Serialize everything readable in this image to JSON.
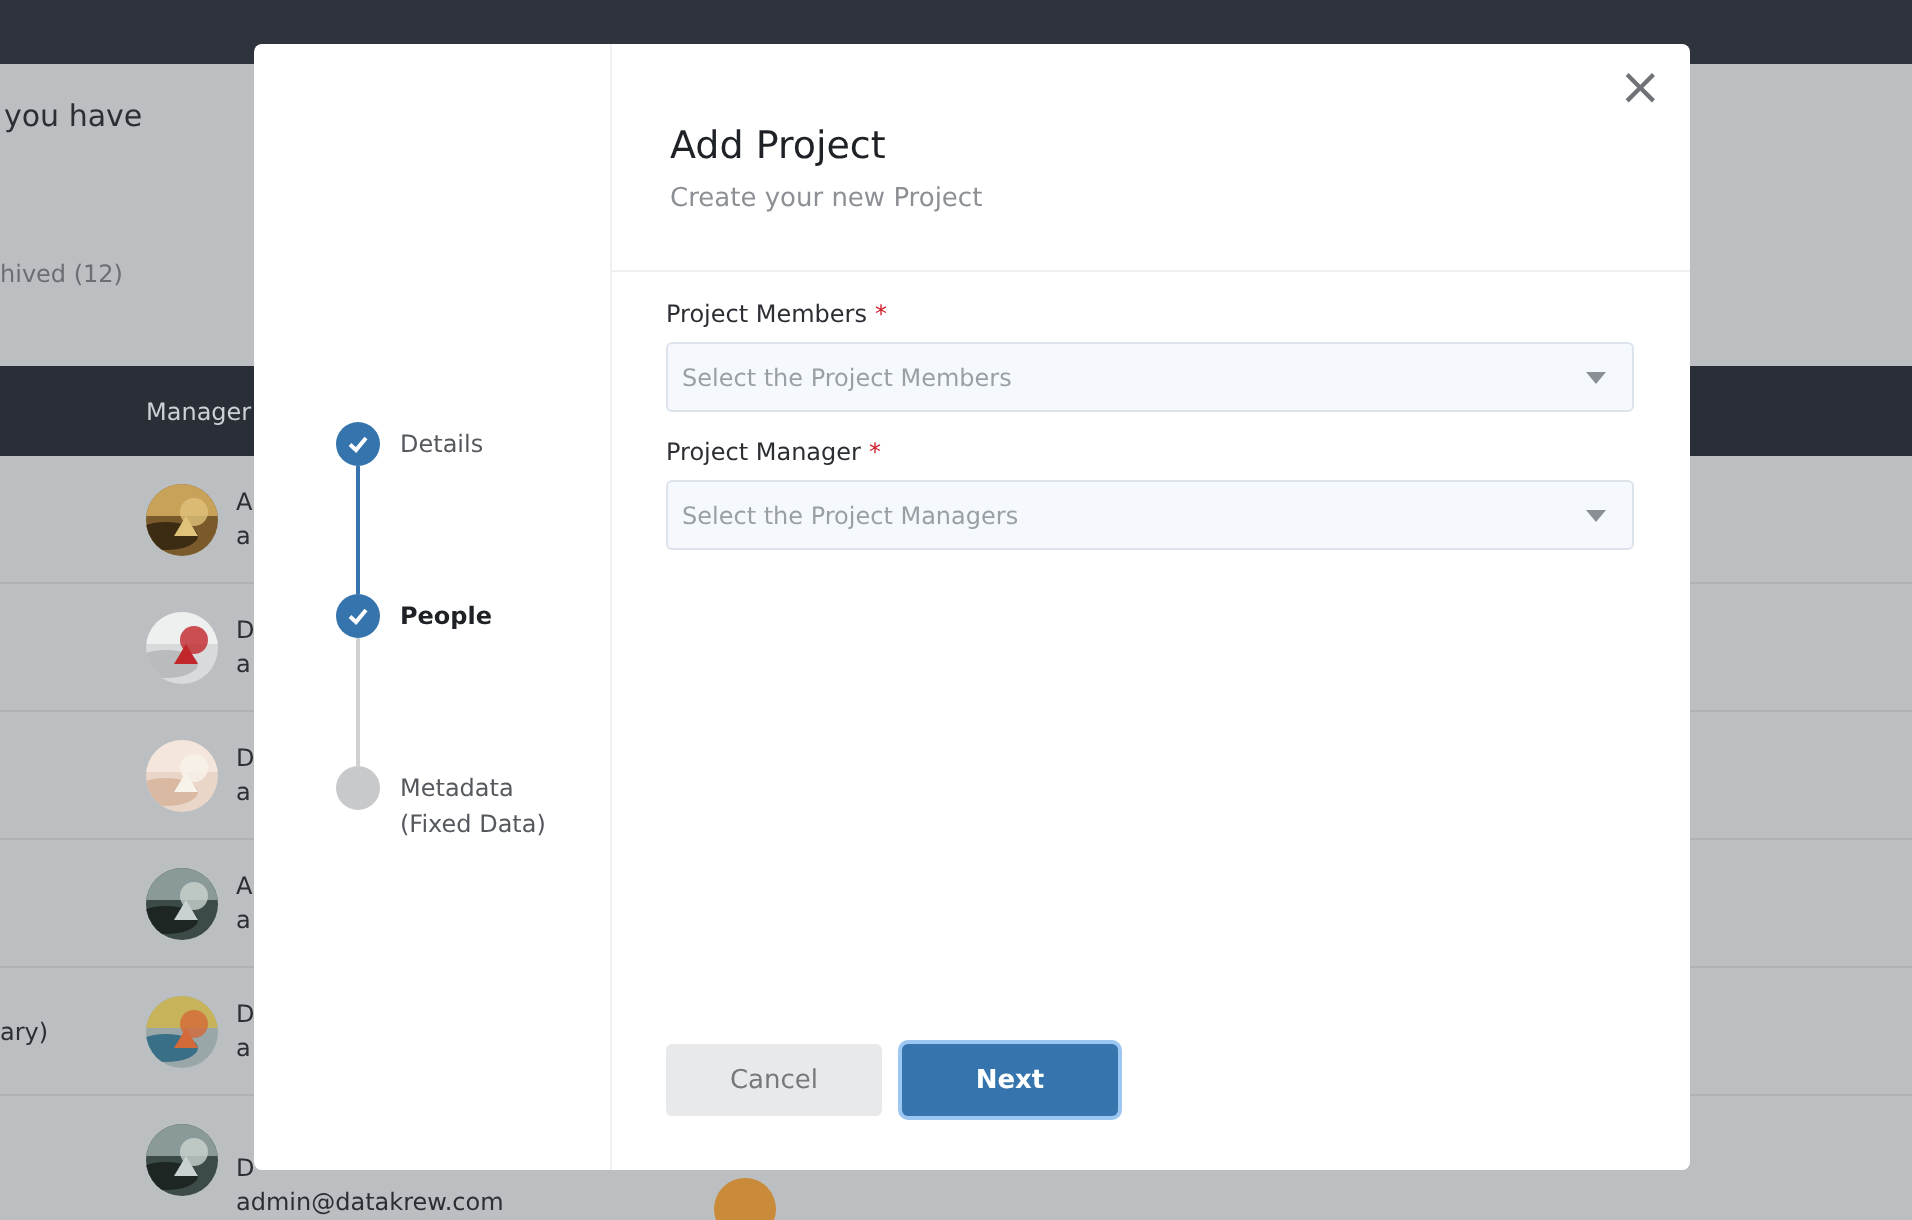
{
  "background": {
    "intro": "you have",
    "tab": "hived (12)",
    "table": {
      "columns": [
        "Manager"
      ],
      "rows": [
        {
          "side": "",
          "name": "A",
          "email": "a"
        },
        {
          "side": "",
          "name": "D",
          "email": "a"
        },
        {
          "side": "",
          "name": "D",
          "email": "a"
        },
        {
          "side": "",
          "name": "A",
          "email": "a"
        },
        {
          "side": "ary)",
          "name": "D",
          "email": "a"
        },
        {
          "side": "",
          "name": "D",
          "email": "admin@datakrew.com"
        }
      ]
    }
  },
  "dialog": {
    "title": "Add Project",
    "subtitle": "Create your new Project",
    "close": "×",
    "steps": [
      {
        "label": "Details",
        "done": true,
        "selected": false
      },
      {
        "label": "People",
        "done": true,
        "selected": true
      },
      {
        "label": "Metadata (Fixed Data)",
        "done": false,
        "selected": false
      }
    ],
    "fields": [
      {
        "label": "Project Members",
        "required": "*",
        "placeholder": "Select the Project Members"
      },
      {
        "label": "Project Manager",
        "required": "*",
        "placeholder": "Select the Project Managers"
      }
    ],
    "buttons": [
      {
        "label": "Cancel",
        "kind": "secondary"
      },
      {
        "label": "Next",
        "kind": "primary"
      }
    ]
  }
}
